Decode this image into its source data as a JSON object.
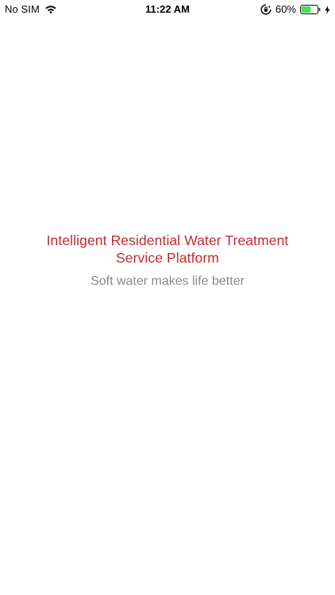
{
  "status_bar": {
    "carrier": "No SIM",
    "time": "11:22 AM",
    "battery_percent": "60%",
    "battery_level": 0.6,
    "icons": {
      "wifi": "wifi-icon",
      "orientation_lock": "orientation-lock-icon",
      "battery": "battery-icon",
      "charging": "charging-bolt-icon"
    },
    "battery_color": "#4cd964"
  },
  "splash": {
    "title": "Intelligent Residential Water Treatment Service Platform",
    "subtitle": "Soft water makes life better",
    "title_color": "#c52a2a",
    "subtitle_color": "#8a8a8a"
  }
}
